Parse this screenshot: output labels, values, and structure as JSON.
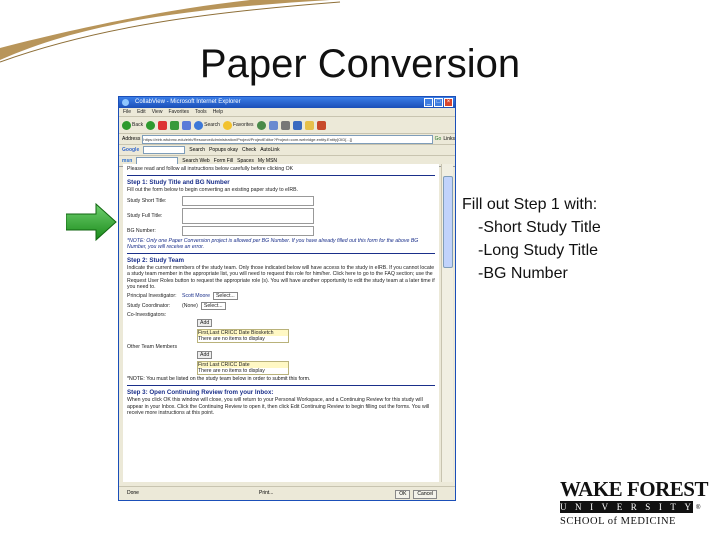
{
  "slide": {
    "title": "Paper Conversion",
    "bullets": {
      "intro": "Fill out Step 1 with:",
      "items": [
        "-Short Study Title",
        "-Long Study Title",
        "-BG Number"
      ]
    }
  },
  "browser": {
    "window_title": "CollabView - Microsoft Internet Explorer",
    "menu": [
      "File",
      "Edit",
      "View",
      "Favorites",
      "Tools",
      "Help"
    ],
    "toolbar": {
      "back": "Back",
      "search": "Search",
      "favorites": "Favorites"
    },
    "address_label": "Address",
    "address_value": "https://eirb.wfubmc.edu/eirb/ResourceAdministration/Project/ProjectEditor?Project=com.webridge.entity.Entity[OID[...]]",
    "go": "Go",
    "links": "Links",
    "google_label": "Google",
    "google_search": "Search",
    "popups": "Popups okay",
    "check": "Check",
    "autolink": "AutoLink",
    "msn_label": "msn",
    "msn_search": "Search Web",
    "form_fill": "Form Fill",
    "spaces": "Spaces",
    "mymsn": "My MSN",
    "status_done": "Done",
    "status_buttons": [
      "OK",
      "Cancel"
    ],
    "status_print": "Print..."
  },
  "form": {
    "intro_note": "Please read and follow all instructions below carefully before clicking OK",
    "step1": {
      "heading": "Step 1: Study Title and BG Number",
      "instruction": "Fill out the form below to begin converting an existing paper study to eIRB.",
      "fields": {
        "short_title": "Study Short Title:",
        "full_title": "Study Full Title:",
        "bg_number": "BG Number:"
      },
      "note": "*NOTE: Only one Paper Conversion project is allowed per BG Number. If you have already filled out this form for the above BG Number, you will receive an error."
    },
    "step2": {
      "heading": "Step 2: Study Team",
      "instruction": "Indicate the current members of the study team. Only those indicated below will have access to the study in eIRB. If you cannot locate a study team member in the appropriate list, you will need to request this role for him/her. Click here to go to the FAQ section; use the Request User Roles button to request the appropriate role (s). You will have another opportunity to edit the study team at a later time if you need to.",
      "pi_label": "Principal Investigator:",
      "pi_value": "Scott Moore",
      "select": "Select...",
      "coordinator_label": "Study Coordinator:",
      "coordinator_value": "(None)",
      "coinvestigators_label": "Co-Investigators:",
      "add": "Add",
      "coinv_header": "First,Last CRICC Date Biosketch",
      "coinv_empty": "There are no items to display",
      "other_label": "Other Team Members",
      "other_header": "First   Last   CRICC Date",
      "other_empty": "There are no items to display",
      "note": "*NOTE: You must be listed on the study team below in order to submit this form."
    },
    "step3": {
      "heading": "Step 3: Open Continuing Review from your Inbox:",
      "text": "When you click OK this window will close, you will return to your Personal Workspace, and a Continuing Review for this study will appear in your Inbox. Click the Continuing Review to open it, then click Edit Continuing Review to begin filling out the forms. You will receive more instructions at this point."
    }
  },
  "logo": {
    "line1": "WAKE FOREST",
    "line2": [
      "U",
      "N",
      "I",
      "V",
      "E",
      "R",
      "S",
      "I",
      "T",
      "Y"
    ],
    "line3": "SCHOOL of MEDICINE",
    "mark": "®"
  },
  "colors": {
    "arrow": "#2aa52a",
    "ie_blue": "#1b4fb8",
    "heading_blue": "#1a2f8a",
    "swoosh": "#a8874a"
  }
}
